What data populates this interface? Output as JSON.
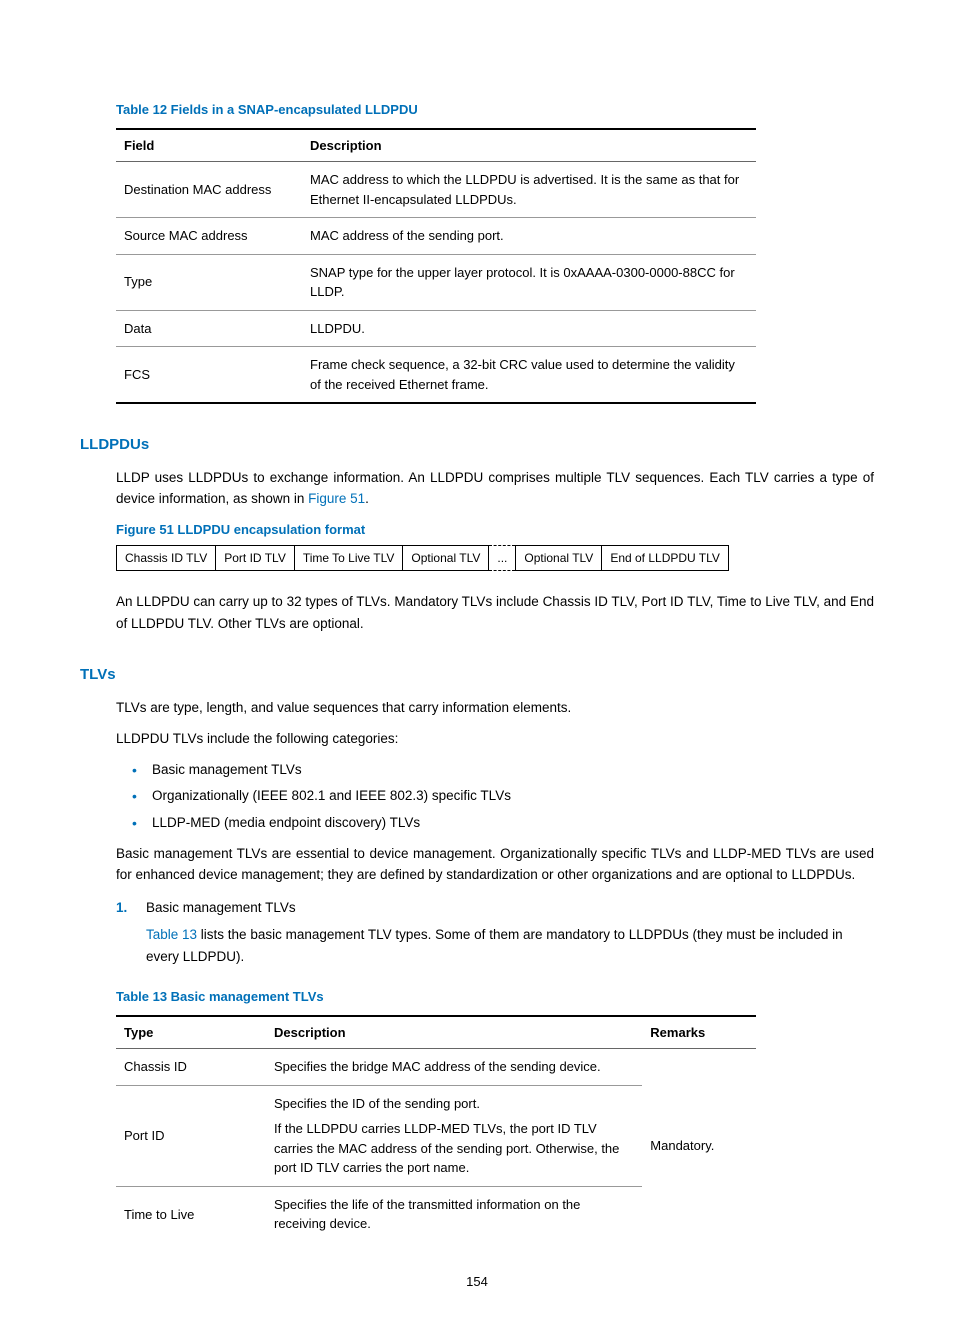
{
  "table12": {
    "caption": "Table 12 Fields in a SNAP-encapsulated LLDPDU",
    "headers": [
      "Field",
      "Description"
    ],
    "rows": [
      [
        "Destination MAC address",
        "MAC address to which the LLDPDU is advertised. It is the same as that for Ethernet II-encapsulated LLDPDUs."
      ],
      [
        "Source MAC address",
        "MAC address of the sending port."
      ],
      [
        "Type",
        "SNAP type for the upper layer protocol. It is 0xAAAA-0300-0000-88CC for LLDP."
      ],
      [
        "Data",
        "LLDPDU."
      ],
      [
        "FCS",
        "Frame check sequence, a 32-bit CRC value used to determine the validity of the received Ethernet frame."
      ]
    ]
  },
  "lldpdus": {
    "heading": "LLDPDUs",
    "p1a": "LLDP uses LLDPDUs to exchange information. An LLDPDU comprises multiple TLV sequences. Each TLV carries a type of device information, as shown in ",
    "p1link": "Figure 51",
    "p1b": ".",
    "fig_caption": "Figure 51 LLDPDU encapsulation format",
    "fig_cells": [
      "Chassis ID TLV",
      "Port ID TLV",
      "Time To Live TLV",
      "Optional TLV",
      "...",
      "Optional TLV",
      "End of LLDPDU TLV"
    ],
    "p2": "An LLDPDU can carry up to 32 types of TLVs. Mandatory TLVs include Chassis ID TLV, Port ID TLV, Time to Live TLV, and End of LLDPDU TLV. Other TLVs are optional."
  },
  "tlvs": {
    "heading": "TLVs",
    "p1": "TLVs are type, length, and value sequences that carry information elements.",
    "p2": "LLDPDU TLVs include the following categories:",
    "bullets": [
      "Basic management TLVs",
      "Organizationally (IEEE 802.1 and IEEE 802.3) specific TLVs",
      "LLDP-MED (media endpoint discovery) TLVs"
    ],
    "p3": "Basic management TLVs are essential to device management. Organizationally specific TLVs and LLDP-MED TLVs are used for enhanced device management; they are defined by standardization or other organizations and are optional to LLDPDUs.",
    "num1_label": "1.",
    "num1_text": "Basic management TLVs",
    "num1_body_link": "Table 13",
    "num1_body": " lists the basic management TLV types. Some of them are mandatory to LLDPDUs (they must be included in every LLDPDU)."
  },
  "table13": {
    "caption": "Table 13 Basic management TLVs",
    "headers": [
      "Type",
      "Description",
      "Remarks"
    ],
    "rows": [
      {
        "type": "Chassis ID",
        "desc": "Specifies the bridge MAC address of the sending device."
      },
      {
        "type": "Port ID",
        "desc_a": "Specifies the ID of the sending port.",
        "desc_b": "If the LLDPDU carries LLDP-MED TLVs, the port ID TLV carries the MAC address of the sending port. Otherwise, the port ID TLV carries the port name."
      },
      {
        "type": "Time to Live",
        "desc": "Specifies the life of the transmitted information on the receiving device."
      }
    ],
    "remarks": "Mandatory."
  },
  "pagenum": "154"
}
